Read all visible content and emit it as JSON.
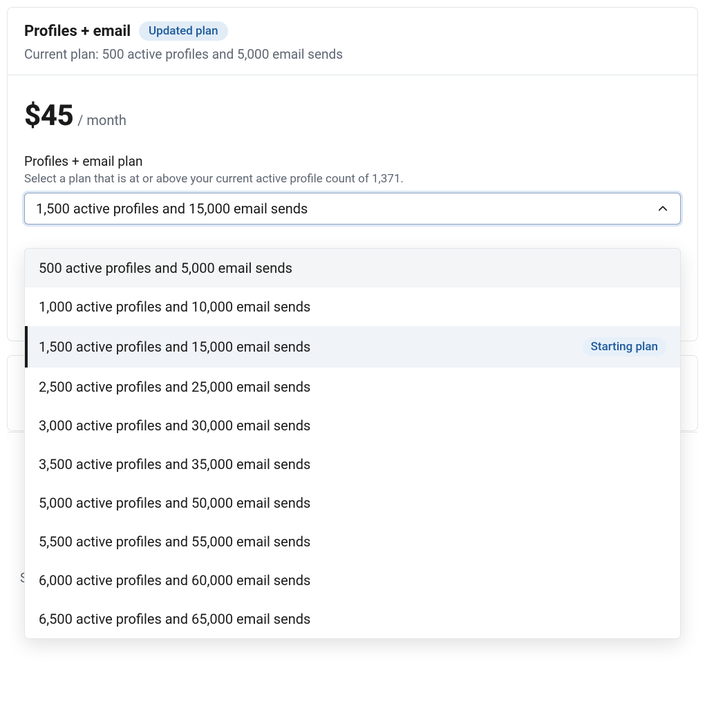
{
  "header": {
    "title": "Profiles + email",
    "badge": "Updated plan",
    "subtitle": "Current plan: 500 active profiles and 5,000 email sends"
  },
  "pricing": {
    "price": "$45",
    "period": "/ month"
  },
  "field": {
    "label": "Profiles + email plan",
    "help": "Select a plan that is at or above your current active profile count of 1,371."
  },
  "select": {
    "value": "1,500 active profiles and 15,000 email sends"
  },
  "options": [
    {
      "label": "500 active profiles and 5,000 email sends",
      "hovered": true,
      "selected": false,
      "badge": ""
    },
    {
      "label": "1,000 active profiles and 10,000 email sends",
      "hovered": false,
      "selected": false,
      "badge": ""
    },
    {
      "label": "1,500 active profiles and 15,000 email sends",
      "hovered": false,
      "selected": true,
      "badge": "Starting plan"
    },
    {
      "label": "2,500 active profiles and 25,000 email sends",
      "hovered": false,
      "selected": false,
      "badge": ""
    },
    {
      "label": "3,000 active profiles and 30,000 email sends",
      "hovered": false,
      "selected": false,
      "badge": ""
    },
    {
      "label": "3,500 active profiles and 35,000 email sends",
      "hovered": false,
      "selected": false,
      "badge": ""
    },
    {
      "label": "5,000 active profiles and 50,000 email sends",
      "hovered": false,
      "selected": false,
      "badge": ""
    },
    {
      "label": "5,500 active profiles and 55,000 email sends",
      "hovered": false,
      "selected": false,
      "badge": ""
    },
    {
      "label": "6,000 active profiles and 60,000 email sends",
      "hovered": false,
      "selected": false,
      "badge": ""
    },
    {
      "label": "6,500 active profiles and 65,000 email sends",
      "hovered": false,
      "selected": false,
      "badge": ""
    }
  ],
  "footnote": "SMS plans are not eligible for proration."
}
